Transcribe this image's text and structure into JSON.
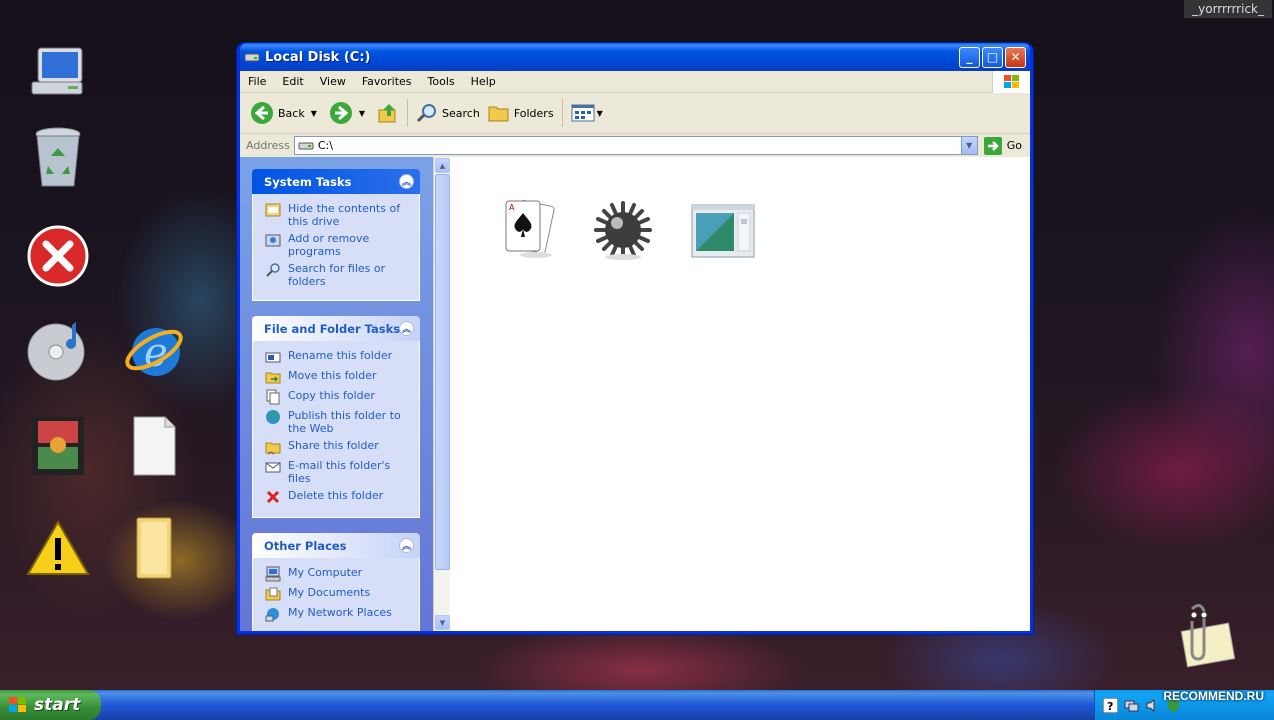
{
  "window": {
    "title": "Local Disk (C:)",
    "menu": [
      "File",
      "Edit",
      "View",
      "Favorites",
      "Tools",
      "Help"
    ],
    "toolbar": {
      "back": "Back",
      "search": "Search",
      "folders": "Folders"
    },
    "address": {
      "label": "Address",
      "value": "C:\\",
      "go": "Go"
    }
  },
  "panels": {
    "system_tasks": {
      "title": "System Tasks",
      "items": [
        "Hide the contents of this drive",
        "Add or remove programs",
        "Search for files or folders"
      ]
    },
    "file_folder_tasks": {
      "title": "File and Folder Tasks",
      "items": [
        "Rename this folder",
        "Move this folder",
        "Copy this folder",
        "Publish this folder to the Web",
        "Share this folder",
        "E-mail this folder's files",
        "Delete this folder"
      ]
    },
    "other_places": {
      "title": "Other Places",
      "items": [
        "My Computer",
        "My Documents",
        "My Network Places"
      ]
    }
  },
  "files": [
    {
      "icon": "solitaire-icon"
    },
    {
      "icon": "minesweeper-icon"
    },
    {
      "icon": "window-app-icon"
    }
  ],
  "taskbar": {
    "start": "start"
  },
  "watermarks": {
    "top": "_yorrrrrrick_",
    "bottom": "RECOMMEND.RU"
  },
  "colors": {
    "title_bar": "#0054e3",
    "task_link": "#215dc6",
    "task_pane": "#6375d6",
    "start_button": "#378d37"
  }
}
